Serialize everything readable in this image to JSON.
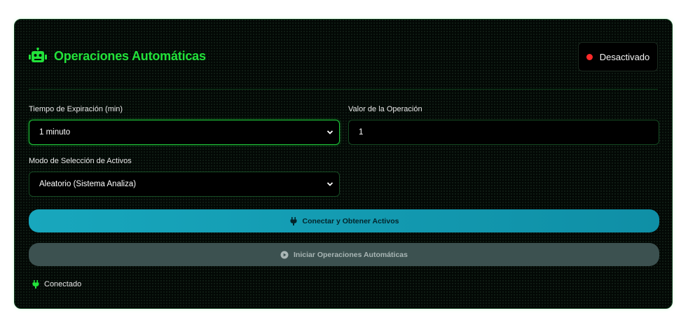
{
  "header": {
    "title": "Operaciones Automáticas",
    "status_label": "Desactivado",
    "status_color": "#ff2a2a",
    "title_icon": "robot-icon"
  },
  "form": {
    "expiry": {
      "label": "Tiempo de Expiración (min)",
      "value": "1 minuto"
    },
    "amount": {
      "label": "Valor de la Operación",
      "value": "1"
    },
    "asset_mode": {
      "label": "Modo de Selección de Activos",
      "value": "Aleatorio (Sistema Analiza)"
    }
  },
  "actions": {
    "connect_label": "Conectar y Obtener Activos",
    "connect_icon": "plug-icon",
    "start_label": "Iniciar Operaciones Automáticas",
    "start_icon": "play-circle-icon"
  },
  "footer": {
    "connection_label": "Conectado",
    "connection_icon": "plug-icon"
  },
  "colors": {
    "accent_green": "#22e23a",
    "connect_button": "#18a7bd",
    "disabled_button": "#3c5150",
    "background": "#030805"
  }
}
